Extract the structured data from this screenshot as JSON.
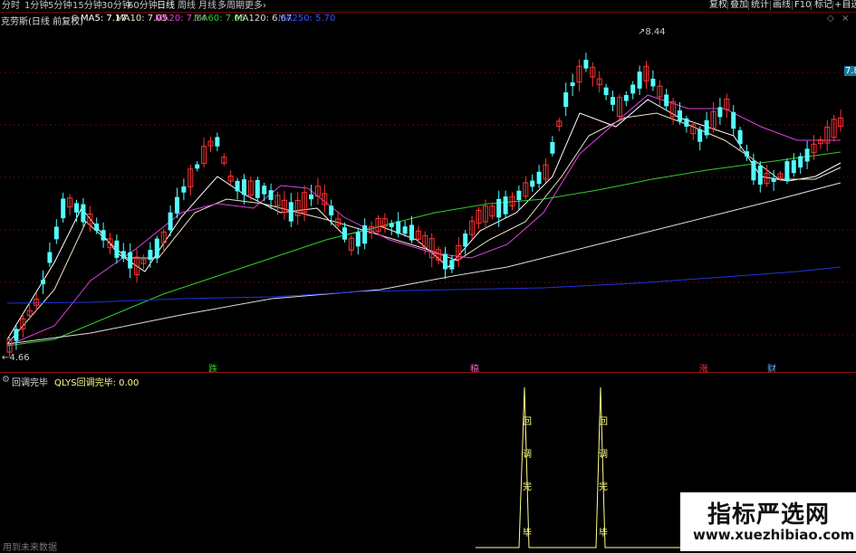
{
  "top_tabs": [
    "分时",
    "1分钟",
    "5分钟",
    "15分钟",
    "30分钟",
    "60分钟",
    "日线",
    "周线",
    "月线",
    "多周期",
    "更多›"
  ],
  "active_tab": "日线",
  "right_buttons": [
    "复权",
    "叠加",
    "统计",
    "画线",
    "F10",
    "标记",
    "+自选"
  ],
  "info": {
    "stock_title": "克劳斯(日线 前复权)",
    "ma": [
      {
        "label": "MA5: 7.17",
        "color": "#ffffff"
      },
      {
        "label": "MA10: 7.05",
        "color": "#f0e6c8"
      },
      {
        "label": "MA20: 7.14",
        "color": "#e040e0"
      },
      {
        "label": "MA60: 7.05",
        "color": "#33cc33"
      },
      {
        "label": "MA120: 6.67",
        "color": "#dddddd"
      },
      {
        "label": "MA250: 5.70",
        "color": "#3355ff"
      }
    ]
  },
  "price_labels": {
    "high": "8.44",
    "low": "4.66",
    "right_edge": "7.8"
  },
  "event_markers": [
    {
      "label": "跌",
      "color": "#33cc33"
    },
    {
      "label": "稿",
      "color": "#ff66cc"
    },
    {
      "label": "涨",
      "color": "#ff3333"
    },
    {
      "label": "财",
      "color": "#66aaff"
    }
  ],
  "indicator": {
    "name": "回调完毕",
    "formula": "QLYS回调完毕: 0.00",
    "peak_text": [
      "回",
      "调",
      "完",
      "毕"
    ],
    "footer": "用到未来数据"
  },
  "watermark": {
    "title": "指标严选网",
    "url": "www.xuezhibiao.com"
  },
  "colors": {
    "up": "#ff3232",
    "down": "#54fcfc",
    "bg": "#000000",
    "grid": "#5a0a0a",
    "ind_line": "#ffff8c"
  }
}
